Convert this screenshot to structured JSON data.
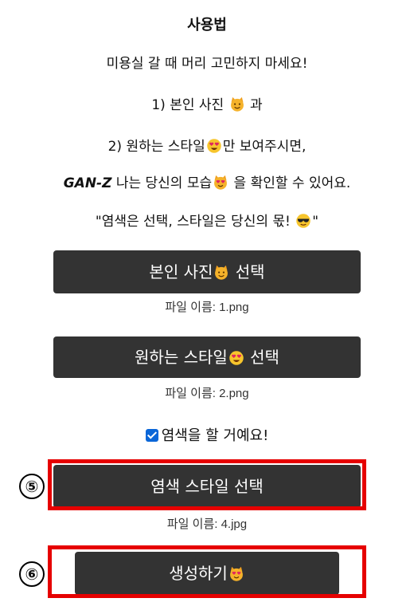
{
  "instructions": {
    "title": "사용법",
    "line1": "미용실 갈 때 머리 고민하지 마세요!",
    "line2_prefix": "1) 본인 사진",
    "line2_suffix": "과",
    "line3_prefix": "2) 원하는 스타일",
    "line3_suffix": "만 보여주시면,",
    "line4_brand": "GAN-Z",
    "line4_mid": "나는 당신의 모습",
    "line4_suffix": "을 확인할 수 있어요.",
    "line5_prefix": "\"염색은 선택, 스타일은 당신의 몫!",
    "line5_suffix": "\""
  },
  "upload_photo": {
    "button_label_prefix": "본인 사진",
    "button_label_suffix": "선택",
    "filename": "파일 이름: 1.png"
  },
  "upload_style": {
    "button_label_prefix": "원하는 스타일",
    "button_label_suffix": "선택",
    "filename": "파일 이름: 2.png"
  },
  "dye_option": {
    "checked": true,
    "label": "염색을 할 거예요!"
  },
  "upload_dye": {
    "button_label": "염색 스타일 선택",
    "filename": "파일 이름: 4.jpg"
  },
  "generate": {
    "button_label": "생성하기"
  },
  "annotations": {
    "marker5": "⑤",
    "marker6": "⑥",
    "highlight_color": "#e60000"
  },
  "icons": [
    "cat-face-icon",
    "heart-eyes-face-icon",
    "heart-eyes-cat-icon",
    "sunglasses-face-icon"
  ]
}
